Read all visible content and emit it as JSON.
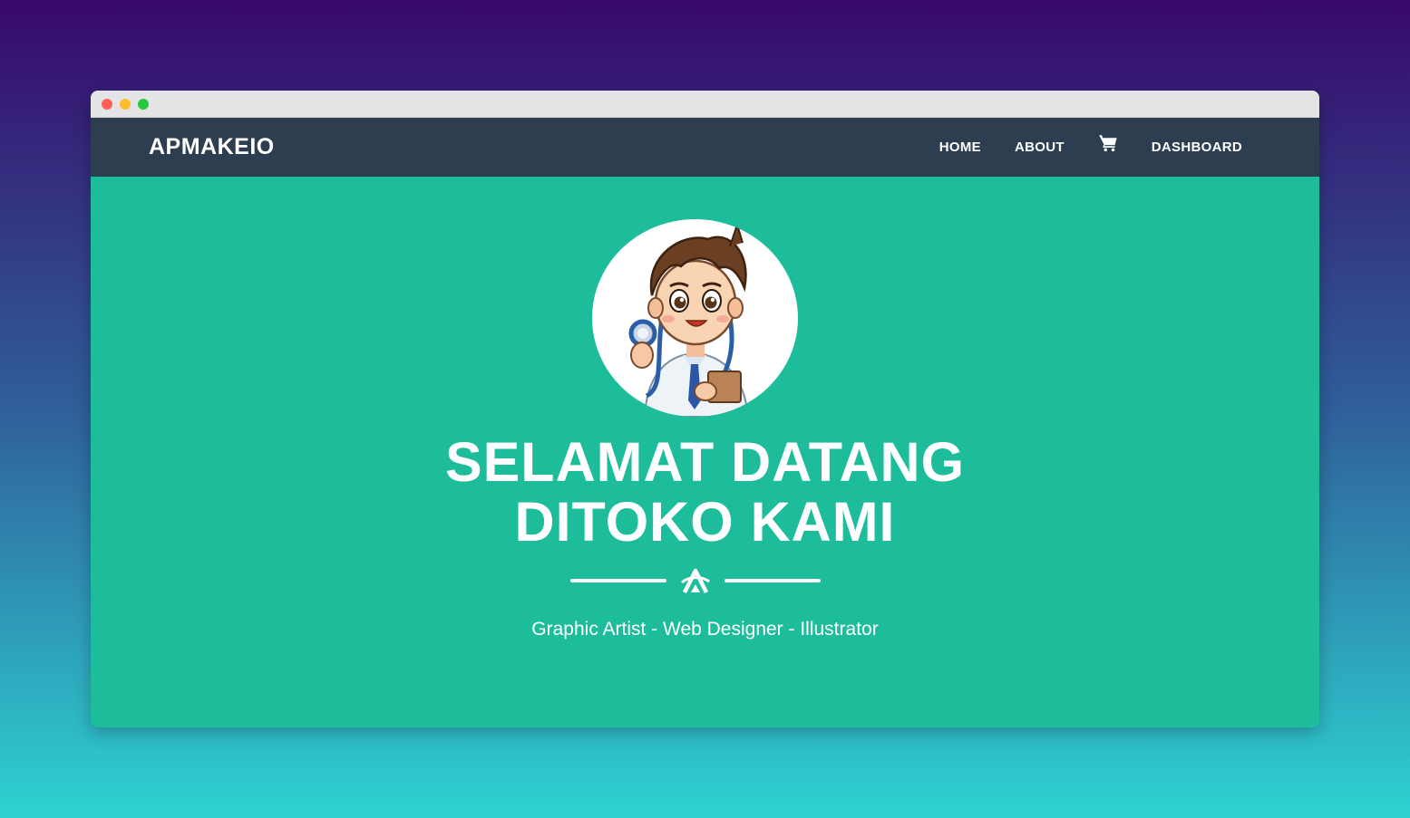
{
  "window": {
    "controls": [
      "close",
      "minimize",
      "maximize"
    ]
  },
  "navbar": {
    "brand": "APMAKEIO",
    "links": [
      {
        "label": "HOME"
      },
      {
        "label": "ABOUT"
      },
      {
        "icon": "cart-icon"
      },
      {
        "label": "DASHBOARD"
      }
    ]
  },
  "hero": {
    "avatar": "doctor-cartoon-avatar",
    "title_line1": "SELAMAT DATANG",
    "title_line2": "DITOKO KAMI",
    "divider_icon": "logo-icon",
    "subtitle": "Graphic Artist - Web Designer - Illustrator"
  },
  "colors": {
    "background_top": "#38096a",
    "background_bottom": "#2ed2d2",
    "navbar": "#2c3e50",
    "hero": "#1dbd9b",
    "text": "#ffffff"
  }
}
